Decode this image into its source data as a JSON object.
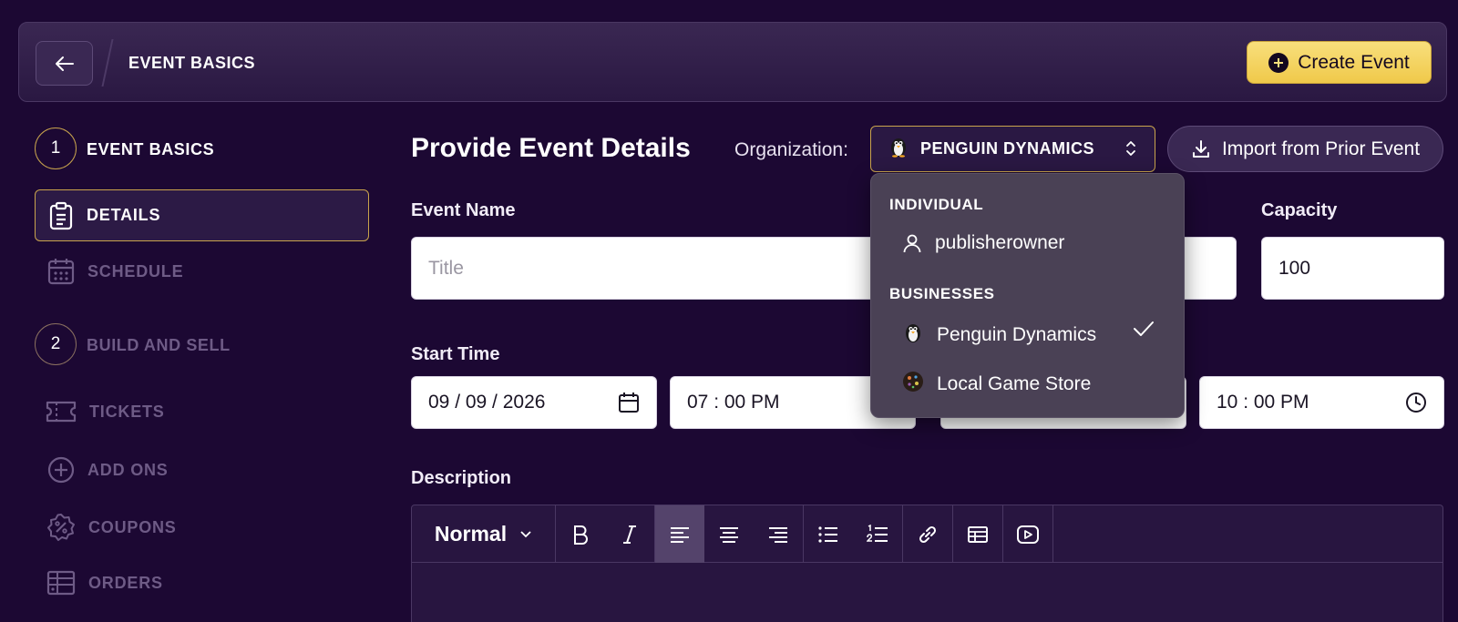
{
  "header": {
    "title": "EVENT BASICS",
    "create_label": "Create Event"
  },
  "sidebar": {
    "step1": {
      "number": "1",
      "label": "EVENT BASICS"
    },
    "step2": {
      "number": "2",
      "label": "BUILD AND SELL"
    },
    "items": [
      {
        "label": "DETAILS",
        "icon": "clipboard-icon",
        "active": true
      },
      {
        "label": "SCHEDULE",
        "icon": "calendar-icon"
      },
      {
        "label": "TICKETS",
        "icon": "ticket-icon"
      },
      {
        "label": "ADD ONS",
        "icon": "plus-circle-icon"
      },
      {
        "label": "COUPONS",
        "icon": "coupon-icon"
      },
      {
        "label": "ORDERS",
        "icon": "orders-icon"
      }
    ]
  },
  "main": {
    "title": "Provide Event Details",
    "org_label": "Organization:",
    "org_selected": "PENGUIN DYNAMICS",
    "import_label": "Import from Prior Event",
    "event_name_label": "Event Name",
    "event_name_placeholder": "Title",
    "capacity_label": "Capacity",
    "capacity_value": "100",
    "start_time_label": "Start Time",
    "start_date": "09 / 09 / 2026",
    "start_time": "07 : 00   PM",
    "end_time": "10 : 00   PM",
    "description_label": "Description",
    "editor": {
      "block_style": "Normal"
    }
  },
  "dropdown": {
    "group_individual": "INDIVIDUAL",
    "individual_item": "publisherowner",
    "group_businesses": "BUSINESSES",
    "business_items": [
      "Penguin Dynamics",
      "Local Game Store"
    ],
    "selected_business": "Penguin Dynamics"
  },
  "colors": {
    "background": "#1c0833",
    "accent_gold": "#c9a44c",
    "create_button": "#f0c94a",
    "dropdown_bg": "#4a4155"
  }
}
